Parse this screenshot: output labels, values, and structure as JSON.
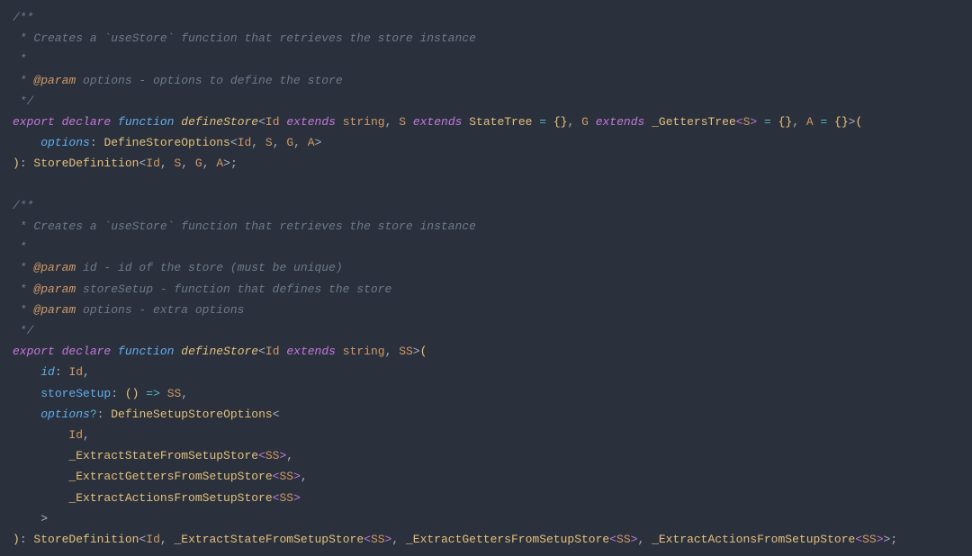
{
  "comment_block_1": {
    "open": "/**",
    "line_desc_prefix": " * ",
    "desc": "Creates a `useStore` function that retrieves the store instance",
    "blank": " *",
    "param_prefix": " * ",
    "param_tag": "@param",
    "param_text": " options - options to define the store",
    "close": " */"
  },
  "sig1": {
    "export": "export",
    "declare": "declare",
    "function": "function",
    "name": "defineStore",
    "lt": "<",
    "id": "Id",
    "extends": "extends",
    "string": "string",
    "comma": ", ",
    "S": "S",
    "StateTree": "StateTree",
    "eq": " = ",
    "empty": "{}",
    "G": "G",
    "GettersTree": "_GettersTree",
    "lt2": "<",
    "S2": "S",
    "gt2": ">",
    "A": "A",
    "gt": ">",
    "lpar": "(",
    "param_name": "options",
    "colon": ": ",
    "DefineStoreOptions": "DefineStoreOptions",
    "args_open": "<",
    "arg_Id": "Id",
    "arg_S": "S",
    "arg_G": "G",
    "arg_A": "A",
    "args_close": ">",
    "rpar": ")",
    "ret_colon": ": ",
    "StoreDefinition": "StoreDefinition",
    "ret_open": "<",
    "ret_Id": "Id",
    "ret_S": "S",
    "ret_G": "G",
    "ret_A": "A",
    "ret_close": ">",
    "semi": ";"
  },
  "comment_block_2": {
    "open": "/**",
    "line_desc_prefix": " * ",
    "desc": "Creates a `useStore` function that retrieves the store instance",
    "blank": " *",
    "p1_prefix": " * ",
    "p_tag": "@param",
    "p1_text": " id - id of the store (must be unique)",
    "p2_prefix": " * ",
    "p2_text": " storeSetup - function that defines the store",
    "p3_prefix": " * ",
    "p3_text": " options - extra options",
    "close": " */"
  },
  "sig2": {
    "export": "export",
    "declare": "declare",
    "function": "function",
    "name": "defineStore",
    "lt": "<",
    "Id": "Id",
    "extends": "extends",
    "string": "string",
    "comma": ", ",
    "SS": "SS",
    "gt": ">",
    "lpar": "(",
    "p_id": "id",
    "p_id_type": "Id",
    "p_store": "storeSetup",
    "p_store_lpar": "(",
    "p_store_rpar": ")",
    "arrow": " => ",
    "p_store_ret": "SS",
    "p_opts": "options",
    "qmark": "?",
    "DefineSetupStoreOptions": "DefineSetupStoreOptions",
    "opts_open": "<",
    "o_Id": "Id",
    "EState": "_ExtractStateFromSetupStore",
    "EGetters": "_ExtractGettersFromSetupStore",
    "EActions": "_ExtractActionsFromSetupStore",
    "ss_open": "<",
    "ss_arg": "SS",
    "ss_close": ">",
    "opts_close": ">",
    "rpar": ")",
    "ret_colon": ": ",
    "StoreDefinition": "StoreDefinition",
    "ret_open": "<",
    "ret_Id": "Id",
    "ret_close": ">",
    "semi": ";",
    "colon": ": ",
    "comma2": ","
  }
}
